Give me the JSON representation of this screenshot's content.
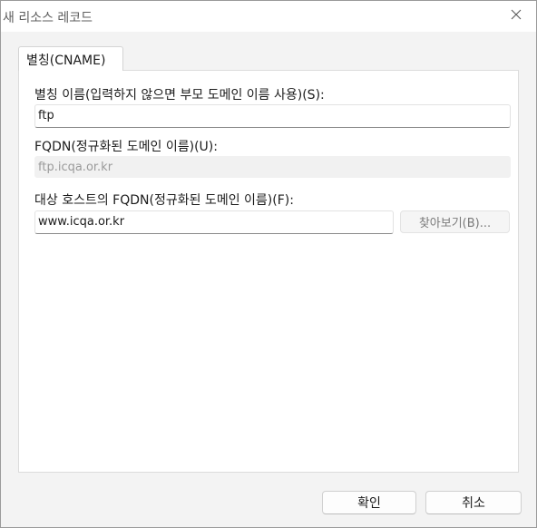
{
  "window": {
    "title": "새 리소스 레코드"
  },
  "tabs": [
    {
      "label": "별칭(CNAME)"
    }
  ],
  "alias": {
    "label": "별칭 이름(입력하지 않으면 부모 도메인 이름 사용)(S):",
    "value": "ftp"
  },
  "fqdn": {
    "label": "FQDN(정규화된 도메인 이름)(U):",
    "value": "ftp.icqa.or.kr"
  },
  "target": {
    "label": "대상 호스트의 FQDN(정규화된 도메인 이름)(F):",
    "value": "www.icqa.or.kr",
    "browse_label": "찾아보기(B)..."
  },
  "footer": {
    "ok_label": "확인",
    "cancel_label": "취소"
  },
  "icons": {
    "close": "close-icon"
  }
}
